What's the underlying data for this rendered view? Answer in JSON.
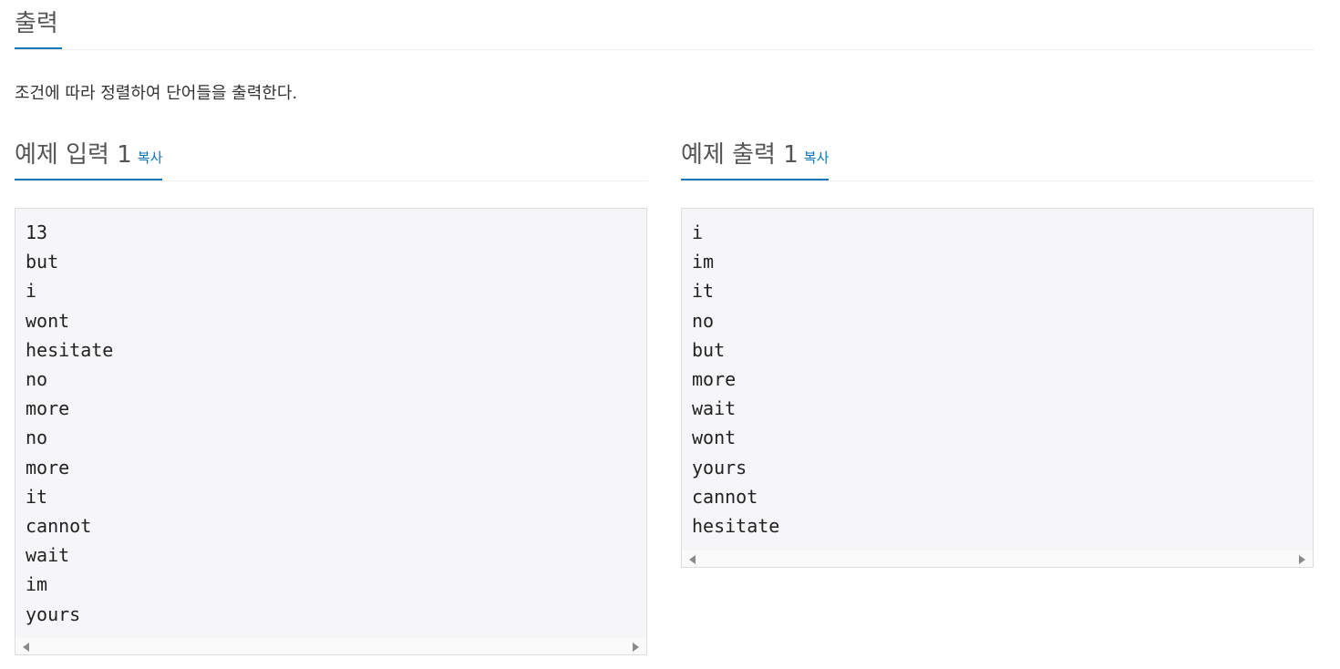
{
  "output_section": {
    "title": "출력",
    "description": "조건에 따라 정렬하여 단어들을 출력한다."
  },
  "sample_input": {
    "title": "예제 입력 1",
    "copy_label": "복사",
    "lines": [
      "13",
      "but",
      "i",
      "wont",
      "hesitate",
      "no",
      "more",
      "no",
      "more",
      "it",
      "cannot",
      "wait",
      "im",
      "yours"
    ]
  },
  "sample_output": {
    "title": "예제 출력 1",
    "copy_label": "복사",
    "lines": [
      "i",
      "im",
      "it",
      "no",
      "but",
      "more",
      "wait",
      "wont",
      "yours",
      "cannot",
      "hesitate"
    ]
  },
  "colors": {
    "accent": "#0e76b8",
    "pre_bg": "#f6f6f8"
  }
}
